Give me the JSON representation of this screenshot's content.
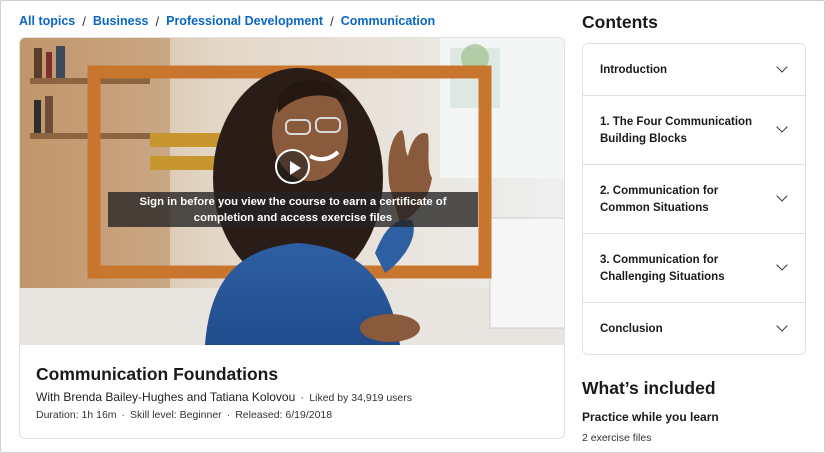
{
  "breadcrumb": {
    "items": [
      "All topics",
      "Business",
      "Professional Development",
      "Communication"
    ],
    "separator": "/"
  },
  "course": {
    "video": {
      "overlay_text": "Sign in before you view the course to earn a certificate of completion and access exercise files",
      "play_icon": "play-icon"
    },
    "title": "Communication Foundations",
    "instructors": "With Brenda Bailey-Hughes and Tatiana Kolovou",
    "likes": "Liked by 34,919 users",
    "duration": "Duration: 1h 16m",
    "skill_level": "Skill level: Beginner",
    "released": "Released: 6/19/2018",
    "meta_separator": "·"
  },
  "contents": {
    "heading": "Contents",
    "sections": [
      {
        "label": "Introduction"
      },
      {
        "label": "1. The Four Communication Building Blocks"
      },
      {
        "label": "2. Communication for Common Situations"
      },
      {
        "label": "3. Communication for Challenging Situations"
      },
      {
        "label": "Conclusion"
      }
    ],
    "expand_icon": "chevron-down-icon"
  },
  "included": {
    "heading": "What’s included",
    "practice_title": "Practice while you learn",
    "exercise_files": "2 exercise files"
  },
  "colors": {
    "link": "#0a66c2",
    "text": "#1f1f1f",
    "border": "#e1e1e1",
    "frame_accent": "#c8762e"
  }
}
